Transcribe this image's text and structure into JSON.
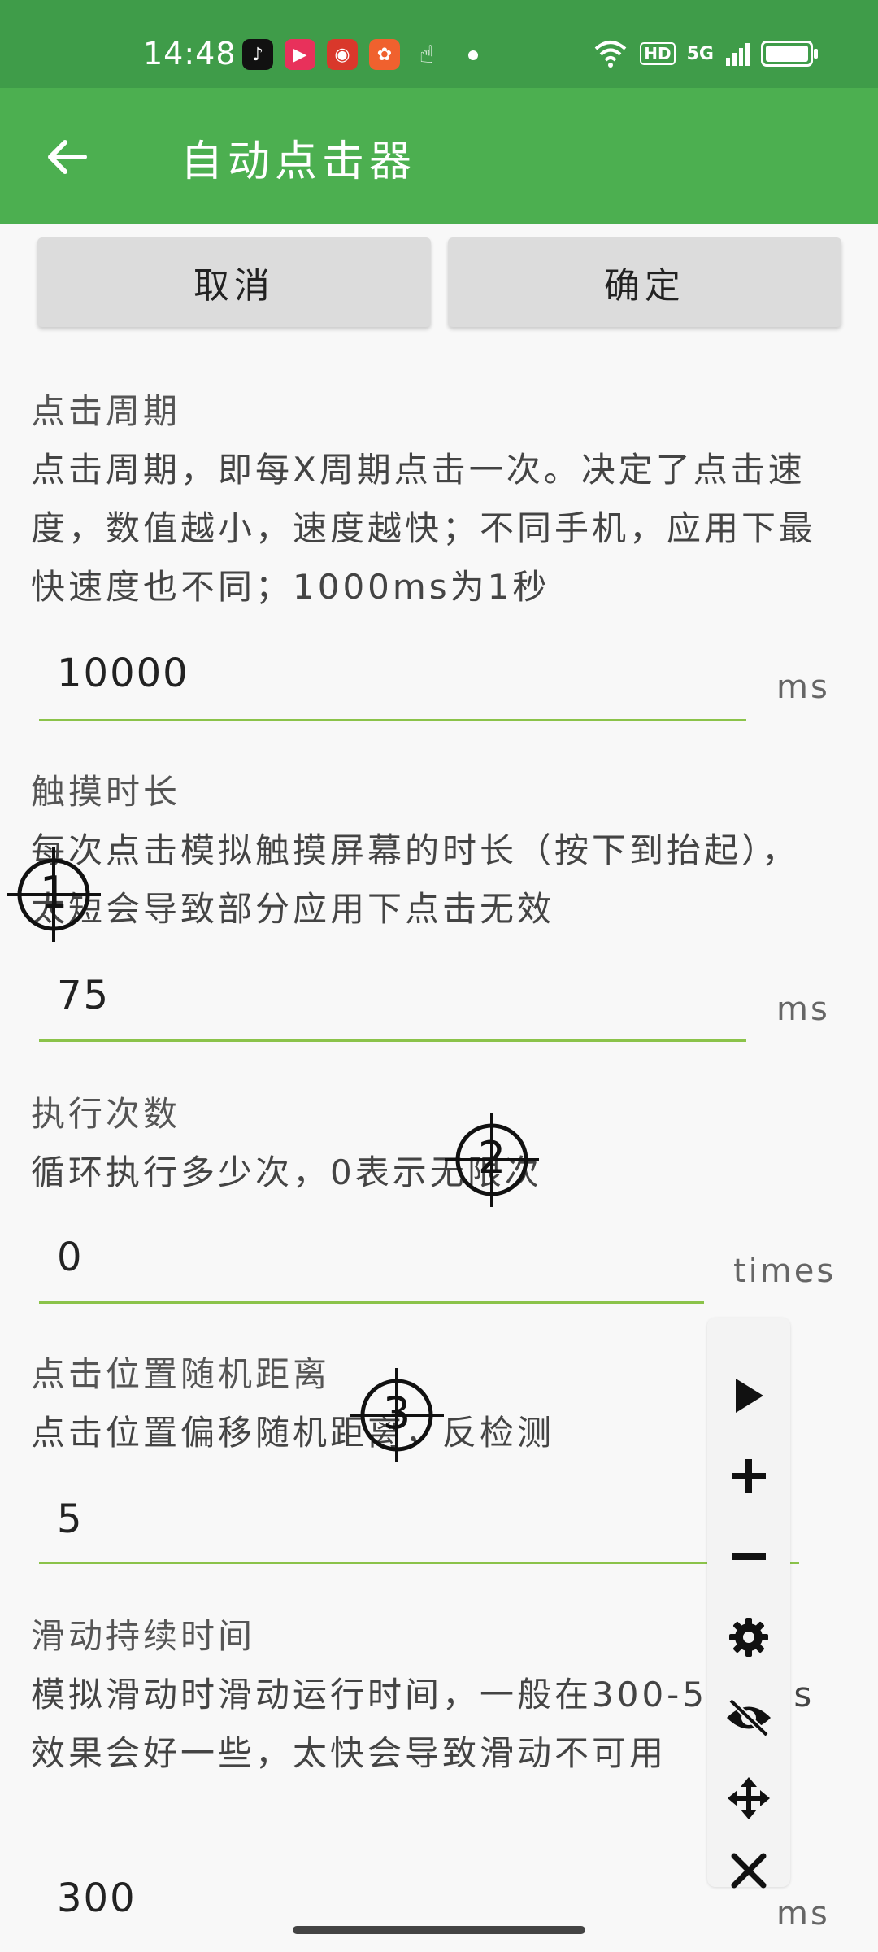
{
  "status_bar": {
    "time": "14:48",
    "network": "5G"
  },
  "app_bar": {
    "title": "自动点击器",
    "back_icon": "arrow-left-icon"
  },
  "buttons": {
    "cancel": "取消",
    "confirm": "确定"
  },
  "sections": {
    "period": {
      "label": "点击周期",
      "description": "点击周期，即每X周期点击一次。决定了点击速度，数值越小，速度越快；不同手机，应用下最快速度也不同；1000ms为1秒",
      "value": "10000",
      "unit": "ms"
    },
    "touch": {
      "label": "触摸时长",
      "description": "每次点击模拟触摸屏幕的时长（按下到抬起），太短会导致部分应用下点击无效",
      "value": "75",
      "unit": "ms"
    },
    "count": {
      "label": "执行次数",
      "description": "循环执行多少次，0表示无限次",
      "value": "0",
      "unit": "times"
    },
    "random": {
      "label": "点击位置随机距离",
      "description": "点击位置偏移随机距离，反检测",
      "value": "5"
    },
    "swipe": {
      "label": "滑动持续时间",
      "description": "模拟滑动时滑动运行时间，一般在300-500ms效果会好一些，太快会导致滑动不可用",
      "value": "300",
      "unit": "ms"
    }
  },
  "targets": [
    "1",
    "2",
    "3"
  ],
  "float_panel": {
    "tools": [
      "play-icon",
      "plus-icon",
      "minus-icon",
      "gear-icon",
      "eye-off-icon",
      "move-icon",
      "close-icon"
    ]
  },
  "colors": {
    "status_bar": "#3f9c49",
    "app_bar": "#4caf50",
    "underline": "#8bc34a",
    "button": "#dcdcdc"
  }
}
